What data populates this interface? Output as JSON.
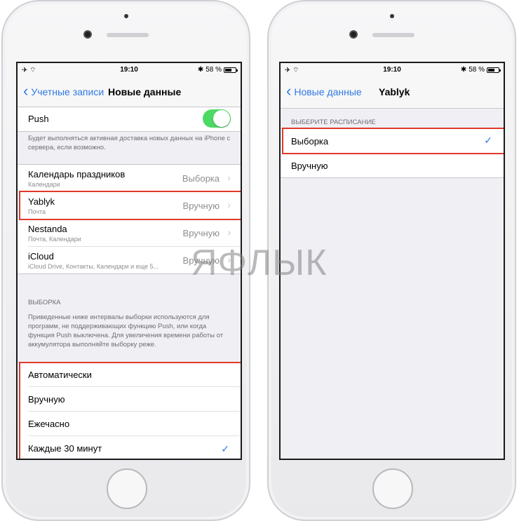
{
  "status_bar": {
    "time": "19:10",
    "battery": "58 %",
    "battery_level": 0.58
  },
  "left_screen": {
    "nav": {
      "back_label": "Учетные записи",
      "title": "Новые данные"
    },
    "push": {
      "label": "Push",
      "enabled": true
    },
    "push_footer": "Будет выполняться активная доставка новых данных на iPhone с сервера, если возможно.",
    "accounts": [
      {
        "name": "Календарь праздников",
        "detail": "Календари",
        "value": "Выборка"
      },
      {
        "name": "Yablyk",
        "detail": "Почта",
        "value": "Вручную"
      },
      {
        "name": "Nestanda",
        "detail": "Почта, Календари",
        "value": "Вручную"
      },
      {
        "name": "iCloud",
        "detail": "iCloud Drive, Контакты, Календари и еще 5...",
        "value": "Вручную"
      }
    ],
    "fetch_header": "ВЫБОРКА",
    "fetch_footer": "Приведенные ниже интервалы выборки используются для программ, не поддерживающих функцию Push, или когда функция Push выключена. Для увеличения времени работы от аккумулятора выполняйте выборку реже.",
    "intervals": [
      {
        "label": "Автоматически",
        "selected": false
      },
      {
        "label": "Вручную",
        "selected": false
      },
      {
        "label": "Ежечасно",
        "selected": false
      },
      {
        "label": "Каждые 30 минут",
        "selected": true
      }
    ]
  },
  "right_screen": {
    "nav": {
      "back_label": "Новые данные",
      "title": "Yablyk"
    },
    "schedule_header": "ВЫБЕРИТЕ РАСПИСАНИЕ",
    "options": [
      {
        "label": "Выборка",
        "selected": true
      },
      {
        "label": "Вручную",
        "selected": false
      }
    ]
  },
  "watermark": "ЯΦЛЫК",
  "icons": {
    "airplane": "airplane-icon",
    "wifi": "wifi-icon",
    "bluetooth": "bluetooth-icon",
    "battery": "battery-icon",
    "chevron": "chevron-right-icon",
    "check": "checkmark-icon",
    "back": "chevron-left-icon"
  },
  "colors": {
    "accent": "#2f7ae5",
    "toggle_on": "#4cd964",
    "highlight": "#e0392b"
  }
}
